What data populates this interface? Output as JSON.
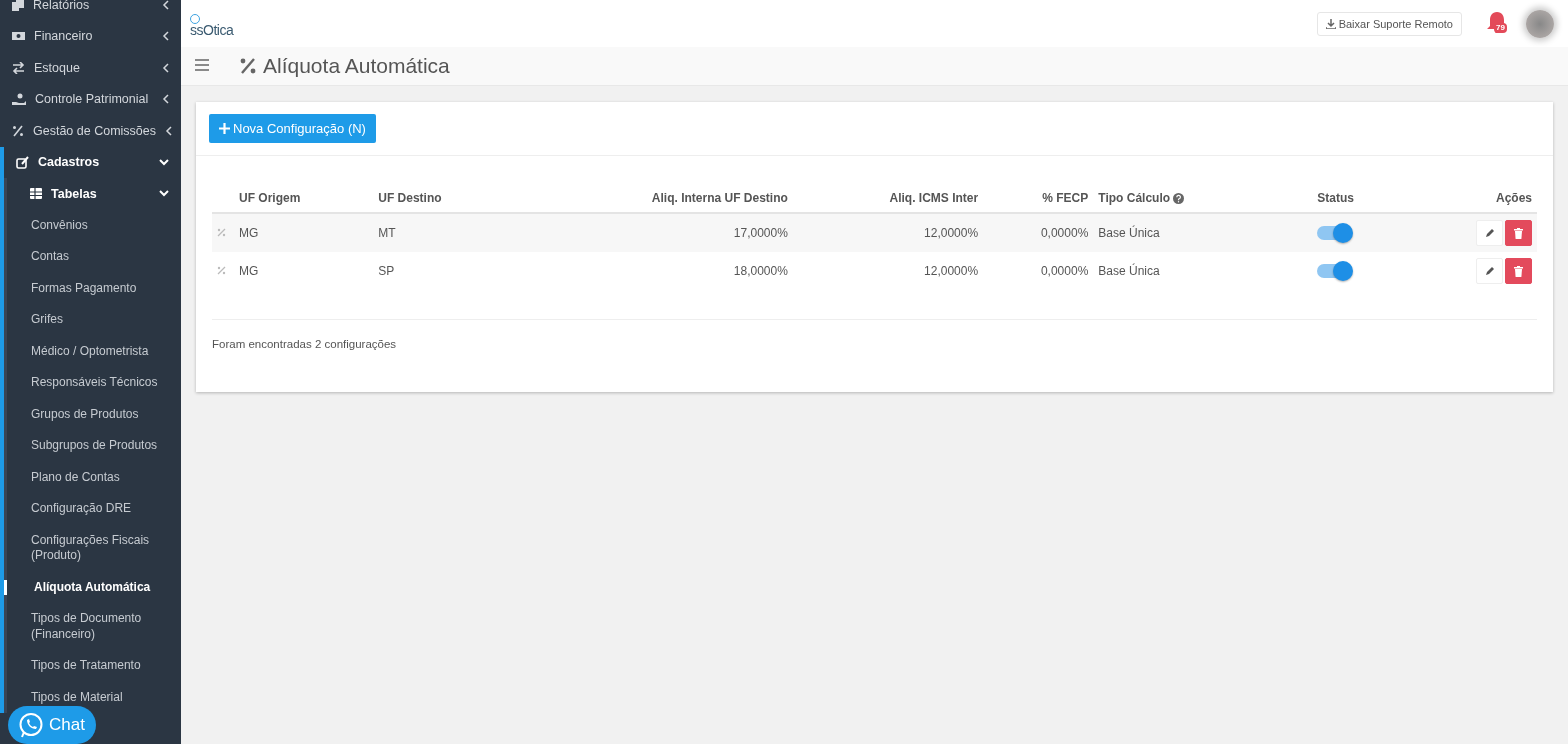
{
  "sidebar": {
    "items": [
      {
        "label": "Relatórios",
        "expanded": false
      },
      {
        "label": "Financeiro",
        "expanded": false
      },
      {
        "label": "Estoque",
        "expanded": false
      },
      {
        "label": "Controle Patrimonial",
        "expanded": false
      },
      {
        "label": "Gestão de Comissões",
        "expanded": false
      },
      {
        "label": "Cadastros",
        "expanded": true,
        "children": [
          {
            "label": "Tabelas",
            "expanded": true,
            "children": [
              {
                "label": "Convênios",
                "selected": false
              },
              {
                "label": "Contas",
                "selected": false
              },
              {
                "label": "Formas Pagamento",
                "selected": false
              },
              {
                "label": "Grifes",
                "selected": false
              },
              {
                "label": "Médico / Optometrista",
                "selected": false
              },
              {
                "label": "Responsáveis Técnicos",
                "selected": false
              },
              {
                "label": "Grupos de Produtos",
                "selected": false
              },
              {
                "label": "Subgrupos de Produtos",
                "selected": false
              },
              {
                "label": "Plano de Contas",
                "selected": false
              },
              {
                "label": "Configuração DRE",
                "selected": false
              },
              {
                "label": "Configurações Fiscais (Produto)",
                "selected": false
              },
              {
                "label": "Alíquota Automática",
                "selected": true
              },
              {
                "label": "Tipos de Documento (Financeiro)",
                "selected": false
              },
              {
                "label": "Tipos de Tratamento",
                "selected": false
              },
              {
                "label": "Tipos de Material",
                "selected": false
              }
            ]
          }
        ]
      }
    ]
  },
  "chat_button": {
    "label": "Chat"
  },
  "header": {
    "logo": "ssOtica",
    "support_button": "Baixar Suporte Remoto",
    "notifications_badge": "79"
  },
  "page_title": "Alíquota Automática",
  "new_button": "Nova Configuração (N)",
  "table": {
    "columns": [
      {
        "label": "UF Origem",
        "help": false
      },
      {
        "label": "UF Destino",
        "help": false
      },
      {
        "label": "Aliq. Interna UF Destino",
        "help": false
      },
      {
        "label": "Aliq. ICMS Inter",
        "help": false
      },
      {
        "label": "% FECP",
        "help": false
      },
      {
        "label": "Tipo Cálculo",
        "help": true
      },
      {
        "label": "Status",
        "help": false
      },
      {
        "label": "Ações",
        "help": false
      }
    ],
    "rows": [
      {
        "uf_origem": "MG",
        "uf_destino": "MT",
        "aliq_interna": "17,0000%",
        "aliq_icms": "12,0000%",
        "fecp": "0,0000%",
        "tipo_calculo": "Base Única",
        "on": true
      },
      {
        "uf_origem": "MG",
        "uf_destino": "SP",
        "aliq_interna": "18,0000%",
        "aliq_icms": "12,0000%",
        "fecp": "0,0000%",
        "tipo_calculo": "Base Única",
        "on": true
      }
    ]
  },
  "footer_text": "Foram encontradas 2 configurações"
}
